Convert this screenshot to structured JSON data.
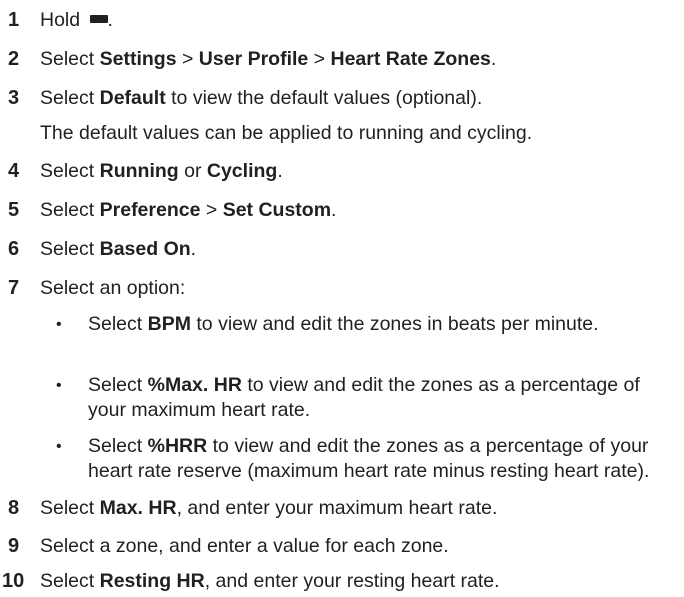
{
  "steps": [
    {
      "num": "1",
      "parts": [
        "Hold ",
        "."
      ]
    },
    {
      "num": "2",
      "parts": [
        "Select ",
        "Settings",
        " > ",
        "User Profile",
        " > ",
        "Heart Rate Zones",
        "."
      ]
    },
    {
      "num": "3",
      "parts": [
        "Select ",
        "Default",
        " to view the default values (optional)."
      ],
      "note": "The default values can be applied to running and cycling."
    },
    {
      "num": "4",
      "parts": [
        "Select ",
        "Running",
        " or ",
        "Cycling",
        "."
      ]
    },
    {
      "num": "5",
      "parts": [
        "Select ",
        "Preference",
        " > ",
        "Set Custom",
        "."
      ]
    },
    {
      "num": "6",
      "parts": [
        "Select ",
        "Based On",
        "."
      ]
    },
    {
      "num": "7",
      "parts": [
        "Select an option:"
      ]
    },
    {
      "num": "8",
      "parts": [
        "Select ",
        "Max. HR",
        ", and enter your maximum heart rate."
      ]
    },
    {
      "num": "9",
      "parts": [
        "Select a zone, and enter a value for each zone."
      ]
    },
    {
      "num": "10",
      "parts": [
        "Select ",
        "Resting HR",
        ", and enter your resting heart rate."
      ]
    }
  ],
  "bullets": [
    {
      "dot": "•",
      "pre": "Select ",
      "bold": "BPM",
      "post": " to view and edit the zones in beats per minute."
    },
    {
      "dot": "•",
      "pre": "Select ",
      "bold": "%Max. HR",
      "post": " to view and edit the zones as a percentage of your maximum heart rate."
    },
    {
      "dot": "•",
      "pre": "Select ",
      "bold": "%HRR",
      "post": " to view and edit the zones as a percentage of your heart rate reserve (maximum heart rate minus resting heart rate)."
    }
  ],
  "icons": {
    "menu": "menu-button-icon"
  }
}
